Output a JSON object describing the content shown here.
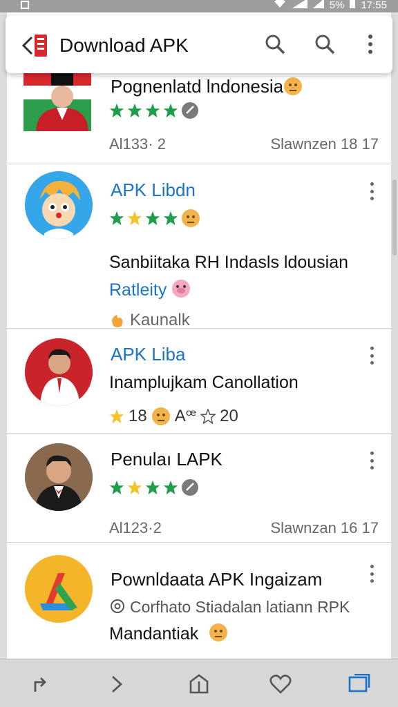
{
  "status_bar": {
    "battery": "5%",
    "time": "17:55"
  },
  "header": {
    "title": "Download APK"
  },
  "cards": [
    {
      "name": "Pognenlatd lndonesia",
      "meta_left": "Al133· 2",
      "meta_right": "Slawnzen 18 17"
    },
    {
      "name": "APK Libdn",
      "line1": "Sanbiitaka RH Indasls ldousian",
      "line2": "Ratleity",
      "line3": "Kaunalk"
    },
    {
      "name": "APK Liba",
      "line1": "Inamplujkam Canollation",
      "rating": "18",
      "extra": "A⁠ꟹ",
      "star_count": "20"
    },
    {
      "name": "Penulaı LAPK",
      "meta_left": "Al123·2",
      "meta_right": "Slawnzan 16 17"
    },
    {
      "name": "Pownldaata APK Ingaizam",
      "line1": "Corfhato Stiadalan latiann RPK",
      "line2": "Mandantiak"
    }
  ],
  "colors": {
    "accent_blue": "#1a73c8",
    "star_green": "#1e9e4a",
    "star_yellow": "#f6c22b",
    "nav_active": "#1a73c8"
  }
}
